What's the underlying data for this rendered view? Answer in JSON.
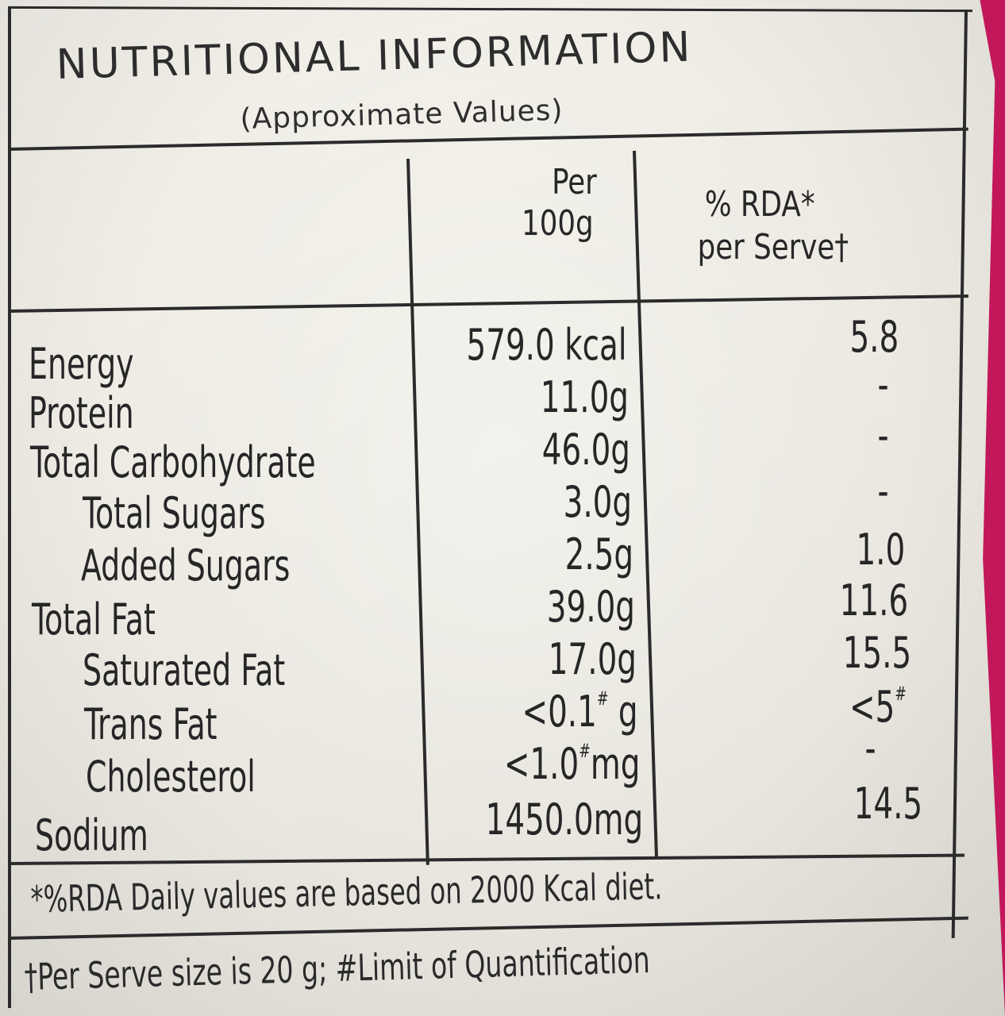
{
  "label": {
    "title": "NUTRITIONAL INFORMATION",
    "subtitle": "(Approximate Values)",
    "col_headers": {
      "per_100g_line1": "Per",
      "per_100g_line2": "100g",
      "rda_line1": "% RDA*",
      "rda_line2": "per Serve†"
    },
    "rows": [
      {
        "name": "Energy",
        "value": "579.0 kcal",
        "rda": "5.8"
      },
      {
        "name": "Protein",
        "value": "11.0g",
        "rda": "-"
      },
      {
        "name": "Total Carbohydrate",
        "value": "46.0g",
        "rda": "-"
      },
      {
        "name": "Total Sugars",
        "value": "3.0g",
        "rda": "-"
      },
      {
        "name": "Added Sugars",
        "value": "2.5g",
        "rda": "1.0"
      },
      {
        "name": "Total Fat",
        "value": "39.0g",
        "rda": "11.6"
      },
      {
        "name": "Saturated Fat",
        "value": "17.0g",
        "rda": "15.5"
      },
      {
        "name": "Trans Fat",
        "value_main": "<0.1",
        "value_mark": "#",
        "value_unit": " g",
        "rda_main": "<5",
        "rda_mark": "#"
      },
      {
        "name": "Cholesterol",
        "value_main": "<1.0",
        "value_mark": "#",
        "value_unit": "mg",
        "rda": "-"
      },
      {
        "name": "Sodium",
        "value": "1450.0mg",
        "rda": "14.5"
      }
    ],
    "footnote_rda": "*%RDA Daily values are based on 2000 Kcal diet.",
    "footnote_serve": "†Per Serve size is 20 g; #Limit of Quantification"
  },
  "colors": {
    "package_pink": "#c2185b",
    "paper": "#eceae2",
    "ink": "#2a2a2a"
  }
}
